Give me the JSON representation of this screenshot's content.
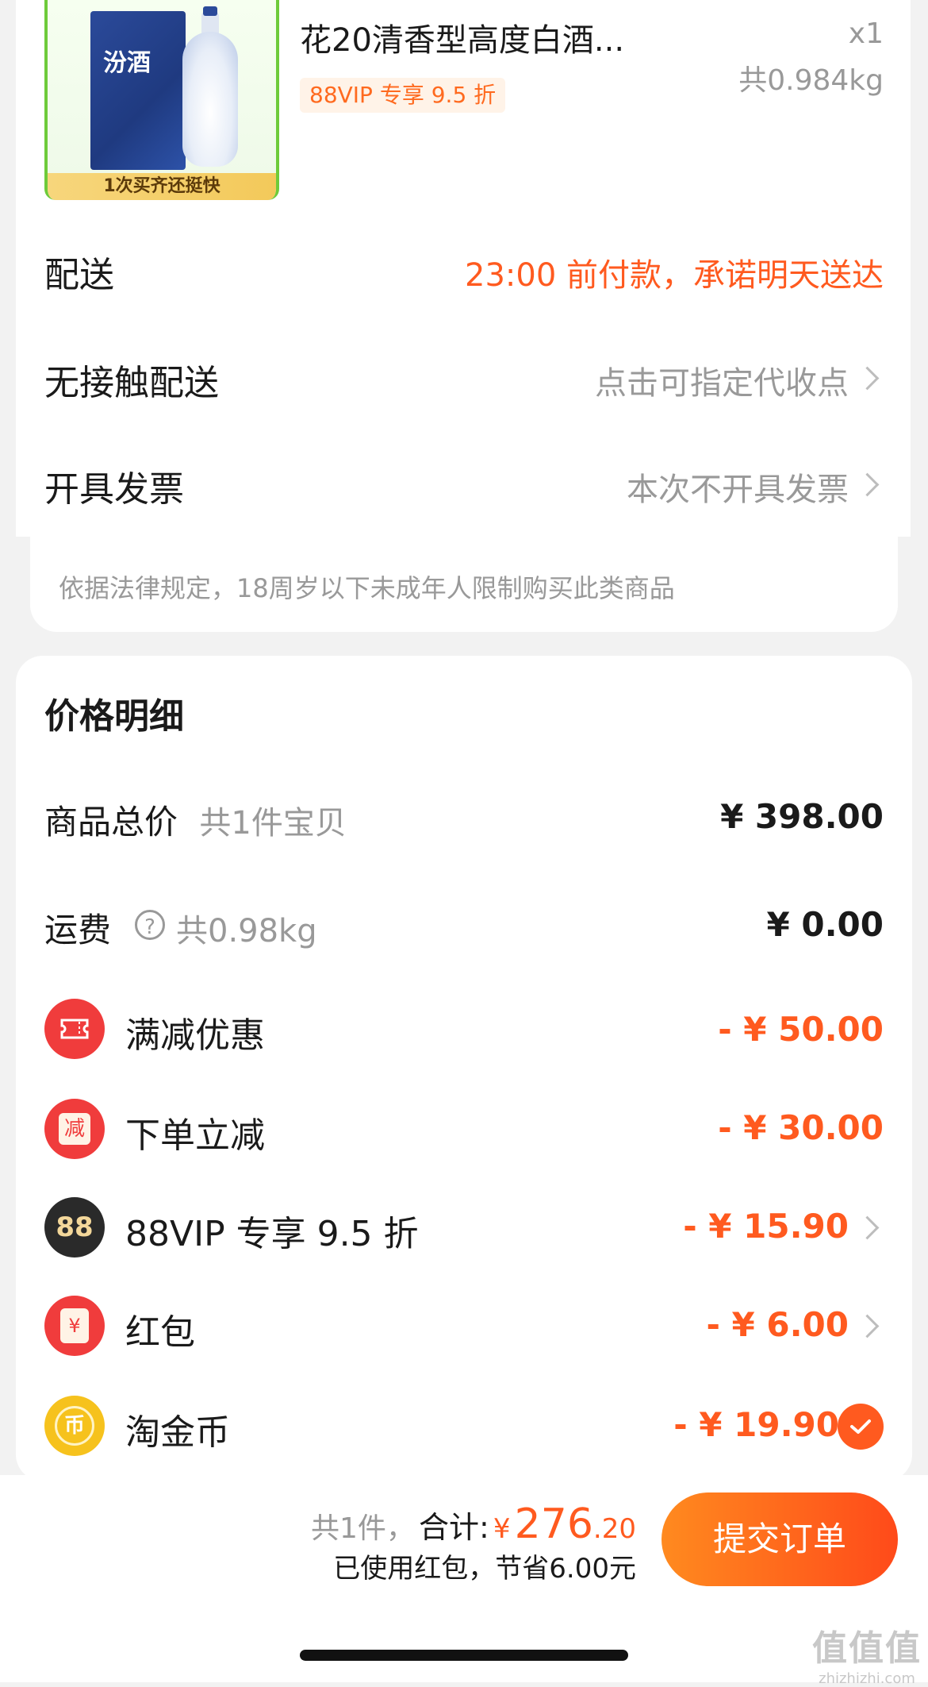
{
  "order": {
    "product": {
      "title": "花20清香型高度白酒...",
      "qty": "x1",
      "weight": "共0.984kg",
      "vip_tag": "88VIP 专享 9.5 折",
      "image_logo": "汾酒",
      "image_banner": "1次买齐还挺快"
    },
    "rows": {
      "delivery_label": "配送",
      "delivery_value": "23:00 前付款，承诺明天送达",
      "contactless_label": "无接触配送",
      "contactless_value": "点击可指定代收点",
      "invoice_label": "开具发票",
      "invoice_value": "本次不开具发票"
    },
    "notice": "依据法律规定，18周岁以下未成年人限制购买此类商品"
  },
  "price_detail": {
    "title": "价格明细",
    "total_label": "商品总价",
    "total_sub": "共1件宝贝",
    "total_amount": "¥ 398.00",
    "shipping_label": "运费",
    "shipping_help": "?",
    "shipping_sub": "共0.98kg",
    "shipping_amount": "¥ 0.00",
    "discounts": [
      {
        "label": "满减优惠",
        "amount": "- ¥ 50.00",
        "icon": "ticket-icon",
        "color": "#f03c3c"
      },
      {
        "label": "下单立减",
        "amount": "- ¥ 30.00",
        "icon": "jian-icon",
        "glyph": "减",
        "color": "#f03c3c"
      },
      {
        "label": "88VIP 专享 9.5 折",
        "amount": "- ¥ 15.90",
        "icon": "vip88-icon",
        "glyph": "88",
        "color": "#2a2a2a"
      },
      {
        "label": "红包",
        "amount": "- ¥ 6.00",
        "icon": "red-packet-icon",
        "glyph": "¥",
        "color": "#f03c3c"
      },
      {
        "label": "淘金币",
        "amount": "- ¥ 19.90",
        "icon": "coin-icon",
        "glyph": "币",
        "color": "#f6c21d"
      }
    ]
  },
  "footer": {
    "count": "共1件，",
    "total_label": "合计:",
    "currency": "¥",
    "total_int": "276",
    "total_dec": ".20",
    "saved": "已使用红包，节省6.00元",
    "submit": "提交订单"
  },
  "watermark": {
    "main": "值值值",
    "sub": "zhizhizhi.com"
  },
  "colors": {
    "accent": "#ff5a1f",
    "button_start": "#ff8a1f",
    "button_end": "#ff4a1a",
    "red": "#f03c3c"
  }
}
